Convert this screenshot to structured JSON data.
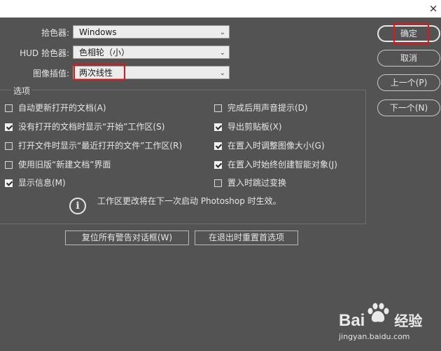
{
  "window": {
    "close_glyph": "×"
  },
  "fields": {
    "color_picker": {
      "label": "拾色器:",
      "value": "Windows"
    },
    "hud_picker": {
      "label": "HUD 拾色器:",
      "value": "色相轮（小）"
    },
    "interpolation": {
      "label": "图像插值:",
      "value": "两次线性"
    }
  },
  "options": {
    "title": "选项",
    "left": [
      {
        "label": "自动更新打开的文档(A)",
        "checked": false
      },
      {
        "label": "没有打开的文档时显示“开始”工作区(S)",
        "checked": true
      },
      {
        "label": "打开文件时显示“最近打开的文件”工作区(R)",
        "checked": false
      },
      {
        "label": "使用旧版“新建文档”界面",
        "checked": false
      },
      {
        "label": "显示信息(M)",
        "checked": true
      }
    ],
    "right": [
      {
        "label": "完成后用声音提示(D)",
        "checked": false
      },
      {
        "label": "导出剪贴板(X)",
        "checked": true
      },
      {
        "label": "在置入时调整图像大小(G)",
        "checked": true
      },
      {
        "label": "在置入时始终创建智能对象(J)",
        "checked": true
      },
      {
        "label": "置入时跳过变换",
        "checked": false
      }
    ],
    "info": "工作区更改将在下一次启动 Photoshop 时生效。"
  },
  "bottom_buttons": {
    "reset_warnings": "复位所有警告对话框(W)",
    "reset_prefs": "在退出时重置首选项"
  },
  "side_buttons": {
    "ok": "确定",
    "cancel": "取消",
    "prev": "上一个(P)",
    "next": "下一个(N)"
  },
  "watermark": {
    "brand_left": "Bai",
    "brand_right": "经验",
    "url": "jingyan.baidu.com"
  },
  "colors": {
    "background": "#535353",
    "highlight": "#e4141b"
  }
}
